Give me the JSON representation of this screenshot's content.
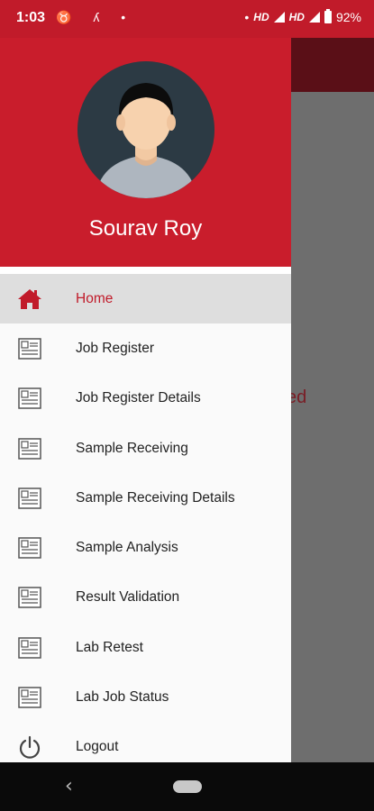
{
  "status_bar": {
    "time": "1:03",
    "left_icons": "♉ ʎ •",
    "dot": "•",
    "hd1": "HD",
    "hd2": "HD",
    "battery": "92%"
  },
  "background": {
    "partial_text": "ed"
  },
  "drawer": {
    "user_name": "Sourav Roy",
    "items": [
      {
        "label": "Home",
        "icon": "home-icon",
        "active": true
      },
      {
        "label": "Job Register",
        "icon": "form-icon"
      },
      {
        "label": "Job Register Details",
        "icon": "form-icon"
      },
      {
        "label": "Sample Receiving",
        "icon": "form-icon"
      },
      {
        "label": "Sample Receiving Details",
        "icon": "form-icon"
      },
      {
        "label": "Sample Analysis",
        "icon": "form-icon"
      },
      {
        "label": "Result Validation",
        "icon": "form-icon"
      },
      {
        "label": "Lab Retest",
        "icon": "form-icon"
      },
      {
        "label": "Lab Job Status",
        "icon": "form-icon"
      },
      {
        "label": "Logout",
        "icon": "power-icon"
      }
    ]
  },
  "colors": {
    "accent": "#c91d2c",
    "active_bg": "#dedede"
  }
}
